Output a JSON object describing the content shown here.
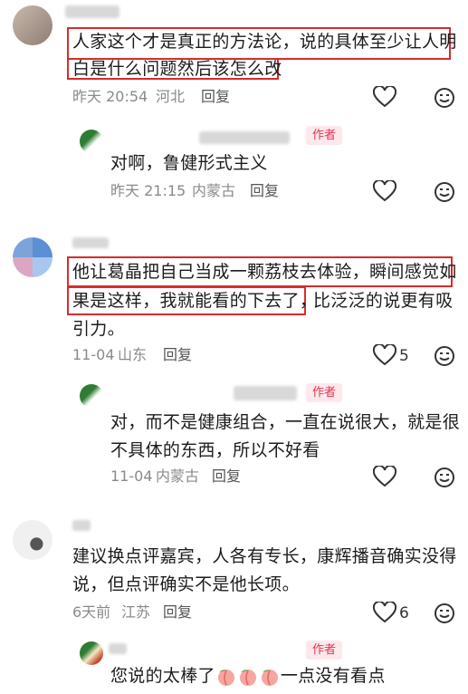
{
  "comments": [
    {
      "text_line1": "人家这个才是真正的方法论，说的具体至少让人明",
      "text_line2": "白是什么问题然后该怎么改",
      "time": "昨天 20:54",
      "location": "河北",
      "reply_label": "回复"
    },
    {
      "author_tag": "作者",
      "text": "对啊，鲁健形式主义",
      "time": "昨天 21:15",
      "location": "内蒙古",
      "reply_label": "回复"
    },
    {
      "text_line1": "他让葛晶把自己当成一颗荔枝去体验，瞬间感觉如",
      "text_line2a": "果是这样，我就能看的下去了，",
      "text_line2b": "比泛泛的说更有吸",
      "text_line3": "引力。",
      "time": "11-04",
      "location": "山东",
      "reply_label": "回复",
      "likes": "5"
    },
    {
      "author_tag": "作者",
      "text_line1": "对，而不是健康组合，一直在说很大，就是很",
      "text_line2": "不具体的东西，所以不好看",
      "time": "11-04",
      "location": "内蒙古",
      "reply_label": "回复"
    },
    {
      "text_line1": "建议换点评嘉宾，人各有专长，康辉播音确实没得",
      "text_line2": "说，但点评确实不是他长项。",
      "time": "6天前",
      "location": "江苏",
      "reply_label": "回复",
      "likes": "6"
    },
    {
      "author_tag": "作者",
      "text_before": "您说的太棒了",
      "text_after": "一点没有看点"
    }
  ],
  "colors": {
    "highlight_box": "#d92b2b",
    "author_tag": "#e0364e"
  },
  "icons": [
    "heart-icon",
    "emoji-icon",
    "peach-emoji"
  ]
}
